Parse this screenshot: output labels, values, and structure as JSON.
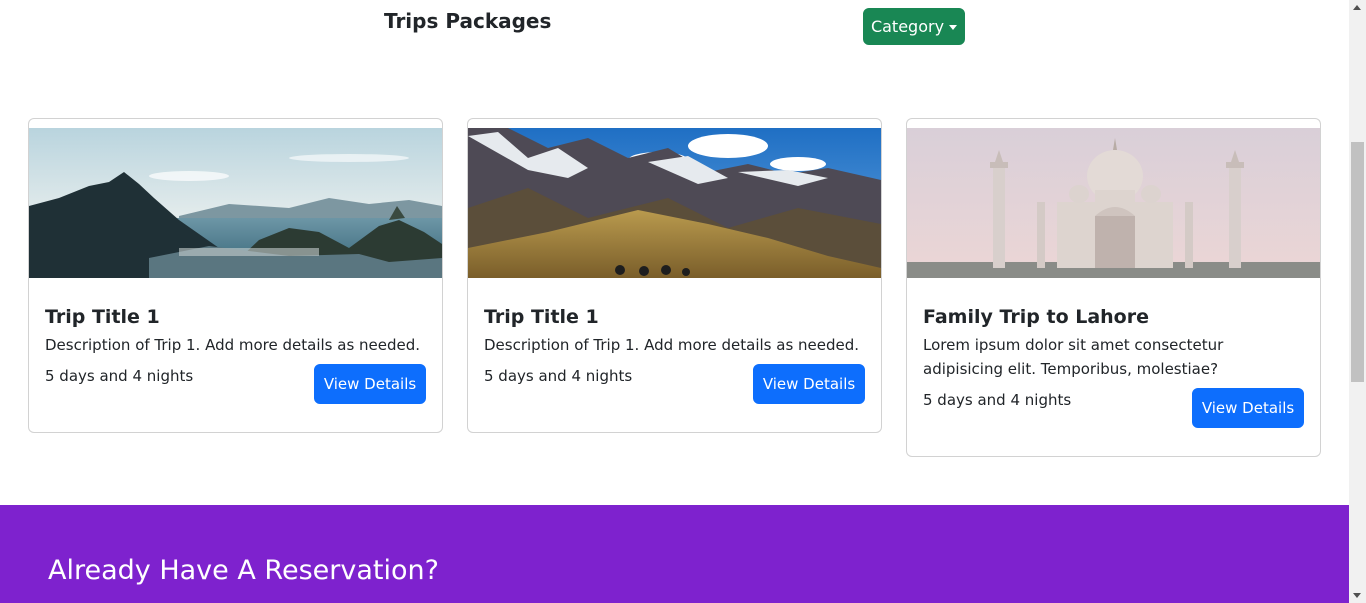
{
  "header": {
    "title": "Trips Packages",
    "category_label": "Category"
  },
  "colors": {
    "category_button": "#198754",
    "primary_button": "#0d6efd",
    "reservation_bg": "#7e22ce"
  },
  "cards": [
    {
      "title": "Trip Title 1",
      "description": "Description of Trip 1. Add more details as needed.",
      "duration": "5 days and 4 nights",
      "button_label": "View Details",
      "image_subject": "coastal-mountain-city-photo"
    },
    {
      "title": "Trip Title 1",
      "description": "Description of Trip 1. Add more details as needed.",
      "duration": "5 days and 4 nights",
      "button_label": "View Details",
      "image_subject": "snowy-mountain-valley-photo"
    },
    {
      "title": "Family Trip to Lahore",
      "description": "Lorem ipsum dolor sit amet consectetur adipisicing elit. Temporibus, molestiae?",
      "duration": "5 days and 4 nights",
      "button_label": "View Details",
      "image_subject": "taj-mahal-photo"
    }
  ],
  "reservation": {
    "title": "Already Have A Reservation?"
  }
}
